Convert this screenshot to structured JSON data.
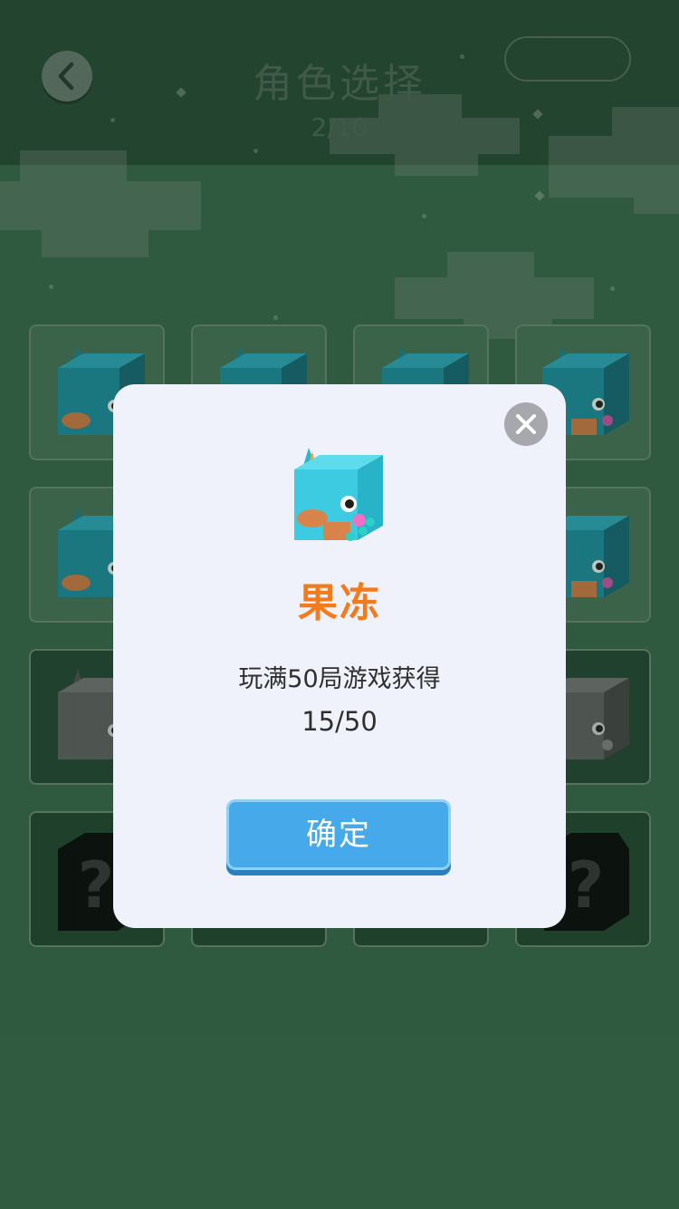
{
  "header": {
    "title": "角色选择",
    "page_indicator": "2/10"
  },
  "grid": {
    "cells": [
      {
        "state": "unlocked"
      },
      {
        "state": "unlocked"
      },
      {
        "state": "unlocked"
      },
      {
        "state": "unlocked"
      },
      {
        "state": "unlocked"
      },
      {
        "state": "unlocked"
      },
      {
        "state": "unlocked"
      },
      {
        "state": "unlocked"
      },
      {
        "state": "locked"
      },
      {
        "state": "locked"
      },
      {
        "state": "locked"
      },
      {
        "state": "locked"
      },
      {
        "state": "unknown"
      },
      {
        "state": "unknown"
      },
      {
        "state": "unknown"
      },
      {
        "state": "unknown"
      }
    ]
  },
  "modal": {
    "character_name": "果冻",
    "unlock_condition": "玩满50局游戏获得",
    "progress": "15/50",
    "confirm_label": "确定"
  },
  "colors": {
    "accent_orange": "#f27b1c",
    "button_blue": "#45a9ea",
    "background_green": "#3c6e50"
  },
  "icons": {
    "back": "chevron-left-icon",
    "close": "close-icon",
    "unknown_character": "question-mark-icon"
  }
}
